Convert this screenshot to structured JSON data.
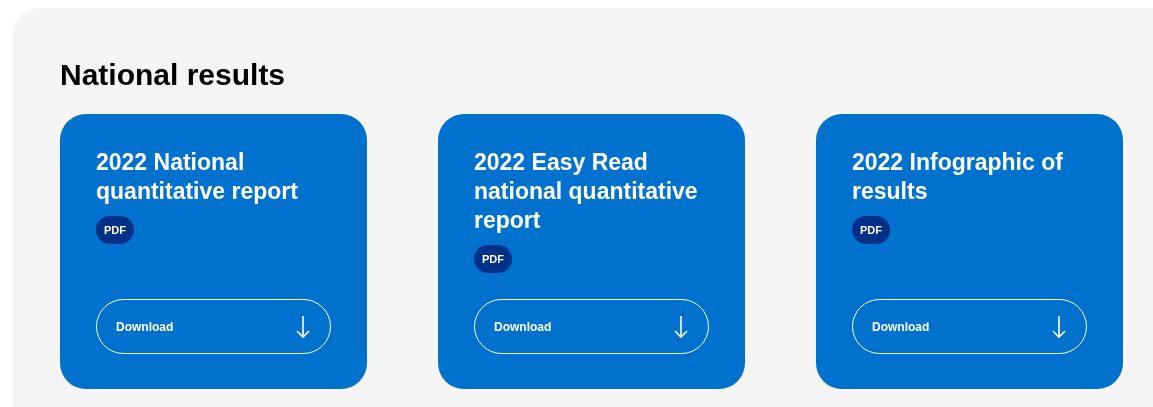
{
  "section": {
    "title": "National results"
  },
  "cards": [
    {
      "title": "2022 National quantitative report",
      "badge": "PDF",
      "button": "Download"
    },
    {
      "title": "2022 Easy Read national quantitative report",
      "badge": "PDF",
      "button": "Download"
    },
    {
      "title": "2022 Infographic of results",
      "badge": "PDF",
      "button": "Download"
    }
  ]
}
